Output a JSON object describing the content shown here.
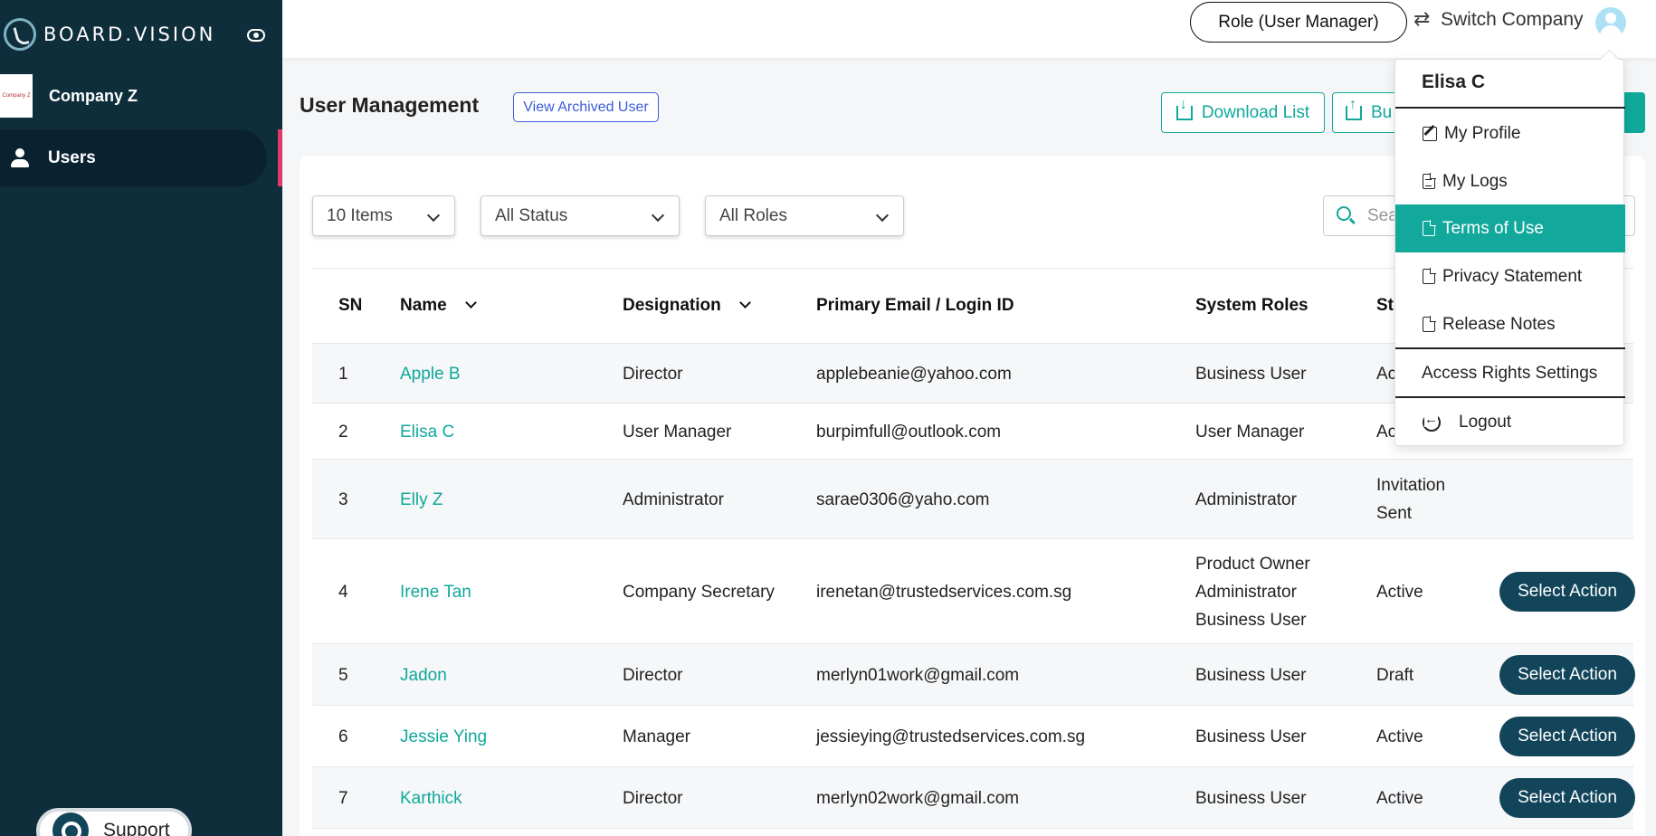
{
  "brand": {
    "logo_text": "BOARD.VISION"
  },
  "sidebar": {
    "company_logo_text": "Company Z",
    "company_name": "Company Z",
    "nav_users_label": "Users",
    "support_label": "Support"
  },
  "topbar": {
    "role_label": "Role (User Manager)",
    "switch_company_label": "Switch Company"
  },
  "page": {
    "title": "User Management",
    "view_archived_label": "View Archived User",
    "download_label": "Download List",
    "bulk_label": "Bu"
  },
  "filters": {
    "items": "10 Items",
    "status": "All Status",
    "roles": "All Roles",
    "search_placeholder": "Sear"
  },
  "table": {
    "headers": {
      "sn": "SN",
      "name": "Name",
      "designation": "Designation",
      "email": "Primary Email / Login ID",
      "roles": "System Roles",
      "status": "St"
    },
    "rows": [
      {
        "sn": "1",
        "name": "Apple B",
        "designation": "Director",
        "email": "applebeanie@yahoo.com",
        "roles": [
          "Business User"
        ],
        "status": [
          "Ac"
        ],
        "action": ""
      },
      {
        "sn": "2",
        "name": "Elisa C",
        "designation": "User Manager",
        "email": "burpimfull@outlook.com",
        "roles": [
          "User Manager"
        ],
        "status": [
          "Ac"
        ],
        "action": ""
      },
      {
        "sn": "3",
        "name": "Elly Z",
        "designation": "Administrator",
        "email": "sarae0306@yaho.com",
        "roles": [
          "Administrator"
        ],
        "status": [
          "Invitation",
          "Sent"
        ],
        "action": ""
      },
      {
        "sn": "4",
        "name": "Irene Tan",
        "designation": "Company Secretary",
        "email": "irenetan@trustedservices.com.sg",
        "roles": [
          "Product Owner",
          "Administrator",
          "Business User"
        ],
        "status": [
          "Active"
        ],
        "action": "Select Action"
      },
      {
        "sn": "5",
        "name": "Jadon",
        "designation": "Director",
        "email": "merlyn01work@gmail.com",
        "roles": [
          "Business User"
        ],
        "status": [
          "Draft"
        ],
        "action": "Select Action"
      },
      {
        "sn": "6",
        "name": "Jessie Ying",
        "designation": "Manager",
        "email": "jessieying@trustedservices.com.sg",
        "roles": [
          "Business User"
        ],
        "status": [
          "Active"
        ],
        "action": "Select Action"
      },
      {
        "sn": "7",
        "name": "Karthick",
        "designation": "Director",
        "email": "merlyn02work@gmail.com",
        "roles": [
          "Business User"
        ],
        "status": [
          "Active"
        ],
        "action": "Select Action"
      }
    ]
  },
  "profile_menu": {
    "user_name": "Elisa C",
    "items": {
      "my_profile": "My Profile",
      "my_logs": "My Logs",
      "terms": "Terms of Use",
      "privacy": "Privacy Statement",
      "release_notes": "Release Notes",
      "access_rights": "Access Rights Settings",
      "logout": "Logout"
    },
    "active_item": "Terms of Use"
  },
  "colors": {
    "sidebar_bg": "#0f2e3b",
    "accent_teal": "#0fa89a",
    "action_button": "#12455a",
    "nav_accent": "#e0396a"
  }
}
